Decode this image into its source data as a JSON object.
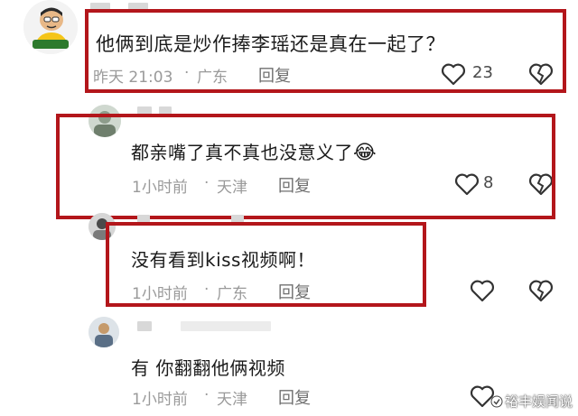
{
  "comments": [
    {
      "text": "他俩到底是炒作捧李瑶还是真在一起了？",
      "time": "昨天 21:03",
      "location": "广东",
      "reply_label": "回复",
      "likes": "23"
    },
    {
      "text": "都亲嘴了真不真也没意义了",
      "emoji": "😂",
      "time": "1小时前",
      "location": "天津",
      "reply_label": "回复",
      "likes": "8"
    },
    {
      "text": "没有看到kiss视频啊！",
      "time": "1小时前",
      "location": "广东",
      "reply_label": "回复",
      "likes": ""
    },
    {
      "text": "有 你翻翻他俩视频",
      "time": "1小时前",
      "location": "天津",
      "reply_label": "回复",
      "likes": ""
    }
  ],
  "separator": "·",
  "watermark": "裕丰娱闻说",
  "colors": {
    "highlight": "#b3161b",
    "meta": "#9a9a9a",
    "text": "#1b1b1b"
  },
  "icons": {
    "like": "heart-outline-icon",
    "dislike": "broken-heart-icon"
  }
}
